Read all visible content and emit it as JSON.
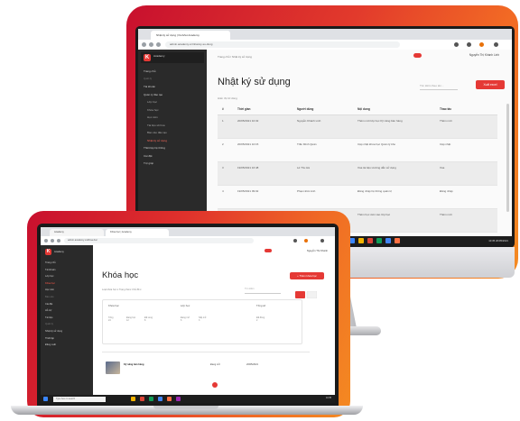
{
  "monitor": {
    "tab_title": "Nhật ký sử dụng | KiotViet Academy",
    "url": "admin.academy.vn/nhat-ky-su-dung",
    "brand": "Academy",
    "user": "Nguyễn Thị Khánh Linh",
    "breadcrumb": "Trang chủ  /  Nhật ký sử dụng",
    "menu": [
      {
        "label": "Trang chủ",
        "cls": "mi"
      },
      {
        "label": "Quản lý",
        "cls": "mi sec"
      },
      {
        "label": "Tài khoản",
        "cls": "mi"
      },
      {
        "label": "Quản lý đào tạo",
        "cls": "mi"
      },
      {
        "label": "Lớp học",
        "cls": "mi sub"
      },
      {
        "label": "Khóa học",
        "cls": "mi sub"
      },
      {
        "label": "Học viên",
        "cls": "mi sub"
      },
      {
        "label": "Tài liệu số hóa",
        "cls": "mi sub"
      },
      {
        "label": "Báo cáo đào tạo",
        "cls": "mi sub"
      },
      {
        "label": "Nhật ký sử dụng",
        "cls": "mi sub act"
      },
      {
        "label": "Thiết lập hệ thống",
        "cls": "mi"
      },
      {
        "label": "Cài đặt",
        "cls": "mi"
      },
      {
        "label": "Trợ giúp",
        "cls": "mi"
      }
    ],
    "page_title": "Nhật ký sử dụng",
    "filter_placeholder": "Tìm kiếm theo tên...",
    "export_label": "Xuất excel",
    "pager": "Hiển thị 10 dòng",
    "columns": [
      "#",
      "Thời gian",
      "Người dùng",
      "Nội dung",
      "Thao tác"
    ],
    "rows": [
      {
        "no": "1",
        "time": "20/05/2021 10:32",
        "user": "Nguyễn Khánh Linh",
        "content": "Thêm mới lớp học Kỹ năng bán hàng",
        "act": "Thêm mới"
      },
      {
        "no": "2",
        "time": "20/05/2021 10:15",
        "user": "Trần Minh Quân",
        "content": "Cập nhật khóa học Quản lý kho",
        "act": "Cập nhật"
      },
      {
        "no": "3",
        "time": "19/05/2021 16:48",
        "user": "Lê Thu Hà",
        "content": "Xóa tài liệu Hướng dẫn sử dụng",
        "act": "Xóa"
      },
      {
        "no": "4",
        "time": "19/05/2021 09:02",
        "user": "Phạm Đức Anh",
        "content": "Đăng nhập hệ thống quản trị",
        "act": "Đăng nhập"
      },
      {
        "no": "5",
        "time": "18/05/2021 14:20",
        "user": "Vũ Hoàng Nam",
        "content": "Thêm học viên vào lớp học",
        "act": "Thêm mới"
      }
    ],
    "clock": "10:35 20/05/2021"
  },
  "laptop": {
    "tabs": [
      "Academy",
      "Khóa học | Academy"
    ],
    "url": "admin.academy.vn/khoa-hoc",
    "brand": "Academy",
    "user": "Nguyễn Thị Khánh",
    "menu": [
      {
        "label": "Trang chủ",
        "cls": "l-mi"
      },
      {
        "label": "Tài khoản",
        "cls": "l-mi"
      },
      {
        "label": "Lớp học",
        "cls": "l-mi"
      },
      {
        "label": "Khóa học",
        "cls": "l-mi act"
      },
      {
        "label": "Học viên",
        "cls": "l-mi"
      },
      {
        "label": "Báo cáo",
        "cls": "l-mi sec"
      },
      {
        "label": "Cài đặt",
        "cls": "l-mi"
      },
      {
        "label": "Hỗ trợ",
        "cls": "l-mi"
      },
      {
        "label": "Tài liệu",
        "cls": "l-mi"
      },
      {
        "label": "Quản lý",
        "cls": "l-mi sec"
      },
      {
        "label": "Nhật ký sử dụng",
        "cls": "l-mi"
      },
      {
        "label": "Thiết lập",
        "cls": "l-mi"
      },
      {
        "label": "Đăng xuất",
        "cls": "l-mi"
      }
    ],
    "page_title": "Khóa học",
    "add_label": "+ Thêm khóa học",
    "filters": "Loại khóa học  ▾    Trạng thái  ▾    Chủ đề  ▾",
    "search_placeholder": "Tìm kiếm",
    "sections": [
      "Khóa học",
      "Lớp học",
      "Tổng số"
    ],
    "stats": [
      "Tổng\n24",
      "Đang học\n12",
      "Đã xong\n8",
      "Đang mở\n6",
      "Sắp mở\n3",
      "Đã đóng\n2"
    ],
    "course_name": "Kỹ năng bán hàng",
    "course_meta": "Đang mở",
    "course_date": "20/05/2021",
    "search_taskbar": "Type here to search",
    "clock": "10:35"
  }
}
